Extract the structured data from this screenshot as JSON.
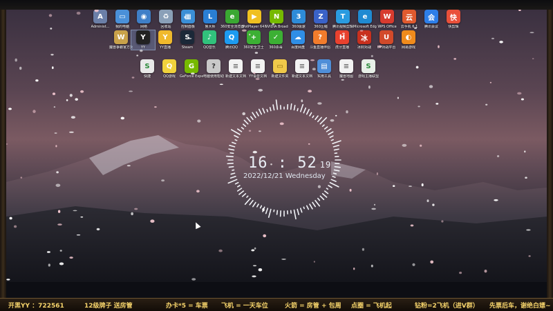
{
  "desktop": {
    "icons_row1": [
      {
        "label": "Administ...",
        "color": "#6b7fa8",
        "glyph": "A"
      },
      {
        "label": "我的电脑",
        "color": "#4a90d9",
        "glyph": "▭"
      },
      {
        "label": "网络",
        "color": "#3f7fc8",
        "glyph": "◉"
      },
      {
        "label": "回收站",
        "color": "#8aa0b8",
        "glyph": "♻"
      },
      {
        "label": "控制面板",
        "color": "#3b8fd6",
        "glyph": "▦"
      },
      {
        "label": "鲁大师",
        "color": "#2a7ed4",
        "glyph": "L"
      },
      {
        "label": "360安全浏览器",
        "color": "#3aa832",
        "glyph": "e"
      },
      {
        "label": "PotPlayer 64 bit",
        "color": "#f0c020",
        "glyph": "▶"
      },
      {
        "label": "NVIDIA Broadcast",
        "color": "#76b900",
        "glyph": "N"
      },
      {
        "label": "360极速",
        "color": "#2e8bd8",
        "glyph": "3"
      },
      {
        "label": "360压缩",
        "color": "#3a62c8",
        "glyph": "Z"
      },
      {
        "label": "腾讯视频剪辑",
        "color": "#2a9be0",
        "glyph": "T"
      },
      {
        "label": "Microsoft Edge",
        "color": "#1f8ad2",
        "glyph": "e"
      },
      {
        "label": "WPS Office",
        "color": "#d73b2f",
        "glyph": "W"
      },
      {
        "label": "云手机 6.1",
        "color": "#e05a2f",
        "glyph": "云"
      },
      {
        "label": "腾讯会议",
        "color": "#2d7ee8",
        "glyph": "会"
      },
      {
        "label": "快剪辑",
        "color": "#e9503a",
        "glyph": "快"
      }
    ],
    "icons_row2": [
      {
        "label": "魔兽争霸官方对战平台",
        "color": "#c9a24a",
        "glyph": "W"
      },
      {
        "label": "YY",
        "color": "#222",
        "glyph": "Y"
      },
      {
        "label": "YY直播",
        "color": "#f0b92c",
        "glyph": "Y"
      },
      {
        "label": "Steam",
        "color": "#1b2838",
        "glyph": "S"
      },
      {
        "label": "QQ音乐",
        "color": "#31c27c",
        "glyph": "♪"
      },
      {
        "label": "腾讯QQ",
        "color": "#1d9bf0",
        "glyph": "Q"
      },
      {
        "label": "360安全卫士",
        "color": "#3cb034",
        "glyph": "+"
      },
      {
        "label": "360杀毒",
        "color": "#3cb034",
        "glyph": "✓"
      },
      {
        "label": "百度网盘",
        "color": "#2f8ee6",
        "glyph": "☁"
      },
      {
        "label": "斗鱼直播伴侣",
        "color": "#f27c2c",
        "glyph": "?"
      },
      {
        "label": "虎牙直播",
        "color": "#e8412e",
        "glyph": "H"
      },
      {
        "label": "冰封对战",
        "color": "#c8301e",
        "glyph": "冰"
      },
      {
        "label": "UP对战平台",
        "color": "#d24a2a",
        "glyph": "U"
      },
      {
        "label": "网易游戏",
        "color": "#f08b1c",
        "glyph": "◐"
      }
    ],
    "icons_row3": [
      {
        "label": "快捷",
        "color": "#e9e9e9",
        "glyph": "S"
      },
      {
        "label": "QQ游戏",
        "color": "#f0d23c",
        "glyph": "Q"
      },
      {
        "label": "GeForce Experience",
        "color": "#76b900",
        "glyph": "G"
      },
      {
        "label": "电脑使用帮助",
        "color": "#c9c9c9",
        "glyph": "?"
      },
      {
        "label": "新建文本文档",
        "color": "#f2f2f2",
        "glyph": "≡"
      },
      {
        "label": "YY语音文档",
        "color": "#f2f2f2",
        "glyph": "≡"
      },
      {
        "label": "新建文件夹",
        "color": "#f0c94a",
        "glyph": "▭"
      },
      {
        "label": "新建文本文档",
        "color": "#f2f2f2",
        "glyph": "≡"
      },
      {
        "label": "实用工具",
        "color": "#4f8ed8",
        "glyph": "▤"
      },
      {
        "label": "魔兽地图",
        "color": "#f2f2f2",
        "glyph": "≡"
      },
      {
        "label": "游戏主播联盟",
        "color": "#e8f0e8",
        "glyph": "S"
      }
    ]
  },
  "clock": {
    "hours": "16",
    "minutes": "52",
    "seconds": "19",
    "date": "2022/12/21 Wednesday"
  },
  "ticker": {
    "items": [
      "开黑YY ：722561",
      "12级牌子 送房管",
      "办卡*5 = 车票",
      "飞机 = 一天车位",
      "火箭 = 房管 + 包周",
      "点圈 = 飞机起",
      "钻粉=2飞机（进V群）",
      "先票后车，谢绝白嫖~"
    ]
  },
  "colors": {
    "ticker_text": "#f5d36b",
    "clock_text": "#e9eef5"
  }
}
